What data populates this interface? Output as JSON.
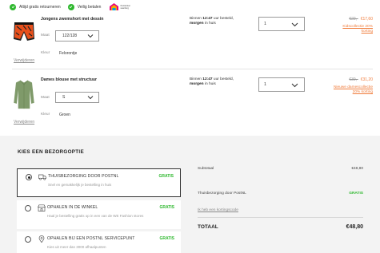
{
  "topbar": {
    "usps": [
      "Altijd gratis retourneren",
      "Veilig betalen"
    ],
    "logo_text": [
      "thuiswinkel",
      "waarborg"
    ],
    "check_color": "#2eb82e"
  },
  "items": [
    {
      "name": "Jongens zwemshort met dessin",
      "size_label": "Maat",
      "size_value": "122/128",
      "color_label": "Kleur",
      "color_value": "Felorontje",
      "remove": "Verwijderen",
      "delivery_pre": "Binnen ",
      "delivery_time": "12:47",
      "delivery_mid": " uur besteld,",
      "delivery_day": "morgen",
      "delivery_post": " in huis",
      "qty": "1",
      "old_price": "€22,-",
      "new_price": "€17,60",
      "promo": [
        "Kidscollectie 20%",
        "korting"
      ]
    },
    {
      "name": "Dames blouse met structuur",
      "size_label": "Maat",
      "size_value": "S",
      "color_label": "Kleur",
      "color_value": "Groen",
      "remove": "Verwijderen",
      "delivery_pre": "Binnen ",
      "delivery_time": "12:47",
      "delivery_mid": " uur besteld,",
      "delivery_day": "morgen",
      "delivery_post": " in huis",
      "qty": "1",
      "old_price": "€39,-",
      "new_price": "€31,20",
      "promo": [
        "Nieuwe damescollectie",
        "20% korting"
      ]
    }
  ],
  "shipping": {
    "title": "KIES EEN BEZORGOPTIE",
    "options": [
      {
        "title": "THUISBEZORGING DOOR POSTNL",
        "subtitle": "Snel en gemakkelijk je bestelling in huis",
        "price": "GRATIS",
        "icon": "truck-icon",
        "selected": true
      },
      {
        "title": "OPHALEN IN DE WINKEL",
        "subtitle": "Haal je bestelling gratis op in een van de WE Fashion stores",
        "price": "GRATIS",
        "icon": "store-icon",
        "selected": false
      },
      {
        "title": "OPHALEN BIJ EEN POSTNL SERVICEPUNT",
        "subtitle": "Kies uit meer dan 3000 afhaalpunten",
        "price": "GRATIS",
        "icon": "location-pin-icon",
        "selected": false
      }
    ]
  },
  "summary": {
    "subtotal_label": "Subtotaal",
    "subtotal_value": "€48,80",
    "shipping_label": "Thuisbezorging door PostNL",
    "shipping_value": "GRATIS",
    "code_link": "Ik heb een kortingscode",
    "total_label": "TOTAAL",
    "total_value": "€48,80"
  },
  "colors": {
    "accent_orange": "#f07b3a",
    "green": "#2eb82e",
    "panel_bg": "#f3f3f3"
  }
}
